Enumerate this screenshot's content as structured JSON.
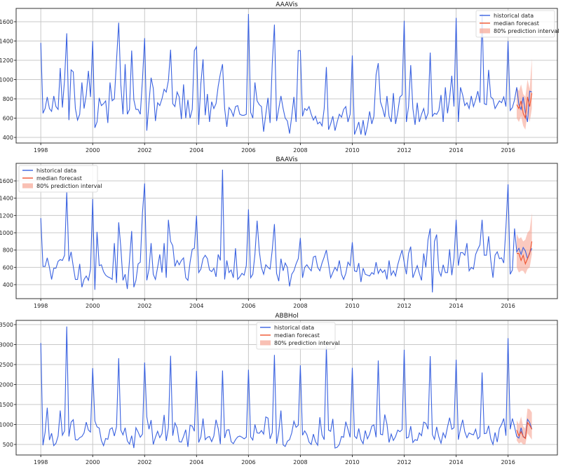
{
  "chart_data": [
    {
      "type": "line",
      "title": "AAAVis",
      "legend_position": "top-right",
      "xlim": [
        1997.05,
        2017.9
      ],
      "ylim": [
        342,
        1738
      ],
      "xticks": [
        1998,
        2000,
        2002,
        2004,
        2006,
        2008,
        2010,
        2012,
        2014,
        2016
      ],
      "yticks": [
        400,
        600,
        800,
        1000,
        1200,
        1400,
        1600
      ],
      "grid": true,
      "start": [
        1998,
        1
      ],
      "historical": [
        1380,
        650,
        700,
        820,
        700,
        670,
        830,
        720,
        690,
        1120,
        710,
        1000,
        1480,
        580,
        1100,
        1080,
        700,
        580,
        640,
        970,
        700,
        840,
        1090,
        820,
        1400,
        500,
        560,
        810,
        730,
        750,
        780,
        550,
        970,
        780,
        800,
        1200,
        1590,
        950,
        640,
        1160,
        640,
        690,
        1300,
        790,
        690,
        690,
        640,
        1000,
        1430,
        470,
        760,
        1020,
        910,
        570,
        760,
        730,
        800,
        900,
        870,
        990,
        1310,
        750,
        720,
        870,
        820,
        590,
        950,
        600,
        790,
        600,
        690,
        1300,
        1340,
        530,
        960,
        1210,
        630,
        850,
        560,
        770,
        700,
        750,
        930,
        1060,
        1160,
        700,
        510,
        710,
        680,
        620,
        720,
        730,
        640,
        630,
        630,
        640,
        1680,
        660,
        600,
        970,
        780,
        740,
        720,
        460,
        640,
        810,
        550,
        1160,
        1570,
        570,
        700,
        830,
        700,
        600,
        570,
        440,
        620,
        820,
        560,
        1300,
        1300,
        620,
        700,
        680,
        720,
        640,
        580,
        620,
        540,
        560,
        520,
        700,
        1130,
        480,
        540,
        620,
        470,
        560,
        640,
        610,
        690,
        720,
        560,
        640,
        1250,
        430,
        490,
        560,
        430,
        580,
        420,
        520,
        670,
        540,
        620,
        1050,
        1170,
        770,
        700,
        610,
        830,
        620,
        560,
        860,
        540,
        660,
        820,
        840,
        1610,
        560,
        720,
        1150,
        700,
        530,
        760,
        560,
        640,
        700,
        590,
        650,
        1280,
        620,
        650,
        640,
        680,
        840,
        560,
        920,
        650,
        810,
        1040,
        720,
        1640,
        560,
        920,
        840,
        730,
        760,
        700,
        830,
        720,
        790,
        880,
        760,
        1680,
        750,
        740,
        1100,
        820,
        800,
        700,
        740,
        780,
        760,
        820,
        720,
        1400,
        680,
        710,
        790,
        920,
        740,
        690,
        820,
        660,
        560,
        880,
        870
      ],
      "forecast_start": [
        2016,
        5
      ],
      "median": [
        740,
        700,
        780,
        650,
        600,
        820,
        720,
        860
      ],
      "lower": [
        600,
        560,
        620,
        520,
        480,
        650,
        560,
        700
      ],
      "upper": [
        920,
        880,
        950,
        850,
        820,
        1000,
        900,
        1220
      ],
      "legend": [
        "historical data",
        "median forecast",
        "80% prediction interval"
      ]
    },
    {
      "type": "line",
      "title": "BAAVis",
      "legend_position": "upper-left",
      "xlim": [
        1997.05,
        2017.9
      ],
      "ylim": [
        238,
        1803
      ],
      "xticks": [
        1998,
        2000,
        2002,
        2004,
        2006,
        2008,
        2010,
        2012,
        2014,
        2016
      ],
      "yticks": [
        400,
        600,
        800,
        1000,
        1200,
        1400,
        1600
      ],
      "grid": true,
      "start": [
        1998,
        1
      ],
      "historical": [
        1170,
        610,
        610,
        710,
        600,
        460,
        590,
        590,
        670,
        690,
        680,
        740,
        1470,
        670,
        780,
        610,
        460,
        460,
        640,
        370,
        460,
        500,
        450,
        580,
        1390,
        340,
        1010,
        620,
        630,
        550,
        510,
        490,
        480,
        460,
        880,
        420,
        1120,
        830,
        450,
        520,
        350,
        680,
        1020,
        370,
        450,
        640,
        660,
        1230,
        1570,
        450,
        580,
        880,
        520,
        460,
        600,
        750,
        540,
        880,
        480,
        1150,
        900,
        850,
        610,
        680,
        630,
        680,
        710,
        480,
        450,
        660,
        810,
        820,
        1200,
        540,
        580,
        700,
        740,
        700,
        570,
        550,
        590,
        490,
        750,
        680,
        1730,
        460,
        680,
        540,
        570,
        480,
        820,
        460,
        490,
        530,
        510,
        620,
        1270,
        480,
        520,
        750,
        1140,
        790,
        600,
        520,
        630,
        600,
        580,
        800,
        1100,
        530,
        440,
        700,
        560,
        650,
        600,
        380,
        520,
        560,
        640,
        700,
        940,
        480,
        600,
        630,
        590,
        560,
        720,
        730,
        600,
        560,
        650,
        720,
        800,
        640,
        480,
        540,
        600,
        560,
        680,
        520,
        460,
        530,
        660,
        620,
        890,
        560,
        550,
        650,
        430,
        590,
        520,
        510,
        500,
        540,
        520,
        660,
        530,
        580,
        540,
        570,
        460,
        680,
        510,
        560,
        500,
        630,
        720,
        800,
        660,
        520,
        760,
        840,
        480,
        550,
        620,
        530,
        450,
        760,
        600,
        920,
        1050,
        310,
        900,
        980,
        560,
        500,
        630,
        540,
        540,
        810,
        510,
        700,
        1150,
        620,
        770,
        770,
        740,
        880,
        560,
        600,
        580,
        750,
        810,
        860,
        1150,
        740,
        740,
        960,
        680,
        480,
        740,
        780,
        700,
        710,
        650,
        1060,
        1560,
        520,
        570,
        1050,
        780,
        820,
        750,
        830,
        790,
        700,
        770,
        820
      ],
      "forecast_start": [
        2016,
        5
      ],
      "median": [
        760,
        760,
        680,
        740,
        640,
        700,
        760,
        900
      ],
      "lower": [
        600,
        540,
        560,
        560,
        520,
        580,
        600,
        750
      ],
      "upper": [
        990,
        930,
        950,
        900,
        920,
        1000,
        1030,
        1230
      ],
      "legend": [
        "historical data",
        "median forecast",
        "80% prediction interval"
      ]
    },
    {
      "type": "line",
      "title": "ABBHol",
      "legend_position": "upper-center",
      "xlim": [
        1997.05,
        2017.9
      ],
      "ylim": [
        237,
        3605
      ],
      "xticks": [
        1998,
        2000,
        2002,
        2004,
        2006,
        2008,
        2010,
        2012,
        2014,
        2016
      ],
      "yticks": [
        500,
        1000,
        1500,
        2000,
        2500,
        3000,
        3500
      ],
      "grid": true,
      "start": [
        1998,
        1
      ],
      "historical": [
        3040,
        480,
        800,
        1420,
        610,
        780,
        470,
        530,
        710,
        1350,
        730,
        840,
        3450,
        700,
        1060,
        1120,
        620,
        610,
        670,
        700,
        790,
        1060,
        860,
        810,
        2410,
        1090,
        940,
        910,
        600,
        470,
        650,
        630,
        880,
        920,
        710,
        950,
        2660,
        860,
        740,
        920,
        590,
        510,
        720,
        410,
        920,
        810,
        680,
        760,
        2550,
        1190,
        880,
        1110,
        500,
        680,
        830,
        670,
        770,
        1240,
        590,
        920,
        2720,
        720,
        1040,
        920,
        570,
        560,
        700,
        870,
        440,
        980,
        960,
        830,
        2340,
        550,
        690,
        1150,
        620,
        680,
        700,
        570,
        710,
        1120,
        900,
        510,
        2350,
        660,
        860,
        870,
        570,
        520,
        620,
        690,
        710,
        680,
        640,
        680,
        2370,
        690,
        610,
        1000,
        790,
        780,
        850,
        760,
        1190,
        1160,
        640,
        800,
        2740,
        520,
        810,
        1350,
        490,
        450,
        580,
        620,
        790,
        1080,
        930,
        980,
        2480,
        730,
        840,
        750,
        560,
        500,
        760,
        570,
        480,
        1180,
        740,
        620,
        2950,
        860,
        830,
        1140,
        410,
        430,
        500,
        700,
        680,
        1070,
        880,
        680,
        2420,
        710,
        650,
        900,
        620,
        520,
        850,
        640,
        760,
        960,
        990,
        680,
        2600,
        760,
        740,
        1250,
        1010,
        550,
        760,
        600,
        700,
        860,
        820,
        870,
        2870,
        660,
        680,
        960,
        550,
        620,
        600,
        790,
        720,
        1060,
        1030,
        880,
        2710,
        750,
        630,
        940,
        690,
        530,
        790,
        670,
        940,
        1170,
        880,
        920,
        2620,
        620,
        900,
        1120,
        820,
        670,
        790,
        760,
        740,
        880,
        640,
        700,
        2300,
        770,
        780,
        970,
        640,
        500,
        800,
        560,
        900,
        1000,
        1150,
        720,
        3160,
        880,
        1150,
        940,
        700,
        660,
        920,
        690,
        670,
        1130,
        1050,
        880
      ],
      "forecast_start": [
        2016,
        5
      ],
      "median": [
        860,
        720,
        820,
        700,
        650,
        1050,
        980,
        880
      ],
      "lower": [
        600,
        520,
        560,
        500,
        500,
        780,
        700,
        620
      ],
      "upper": [
        1100,
        1000,
        1200,
        950,
        900,
        1400,
        1380,
        1300
      ],
      "legend": [
        "historical data",
        "median forecast",
        "80% prediction interval"
      ]
    }
  ],
  "colors": {
    "historical": "#3a62e0",
    "median": "#f0522e",
    "interval": "#f7a594"
  }
}
